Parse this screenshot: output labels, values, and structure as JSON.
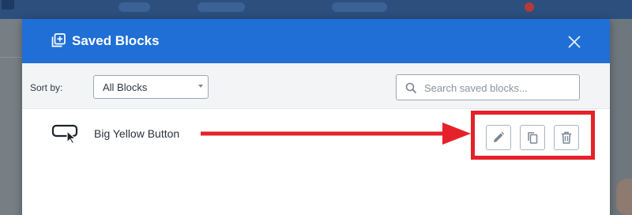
{
  "modal": {
    "title": "Saved Blocks",
    "header_icon": "plus-square-icon",
    "close_icon": "close-icon"
  },
  "toolbar": {
    "sort_label": "Sort by:",
    "sort_value": "All Blocks",
    "search_placeholder": "Search saved blocks...",
    "search_value": ""
  },
  "blocks": [
    {
      "name": "Big Yellow Button",
      "icon": "button-cursor-icon",
      "actions": [
        {
          "name": "edit",
          "icon": "pencil-icon"
        },
        {
          "name": "duplicate",
          "icon": "copy-icon"
        },
        {
          "name": "delete",
          "icon": "trash-icon"
        }
      ]
    }
  ],
  "annotation": {
    "color": "#e52129",
    "type": "arrow-with-highlight-box"
  },
  "colors": {
    "header": "#1f6fd6",
    "toolbar_bg": "#f3f4f6"
  }
}
